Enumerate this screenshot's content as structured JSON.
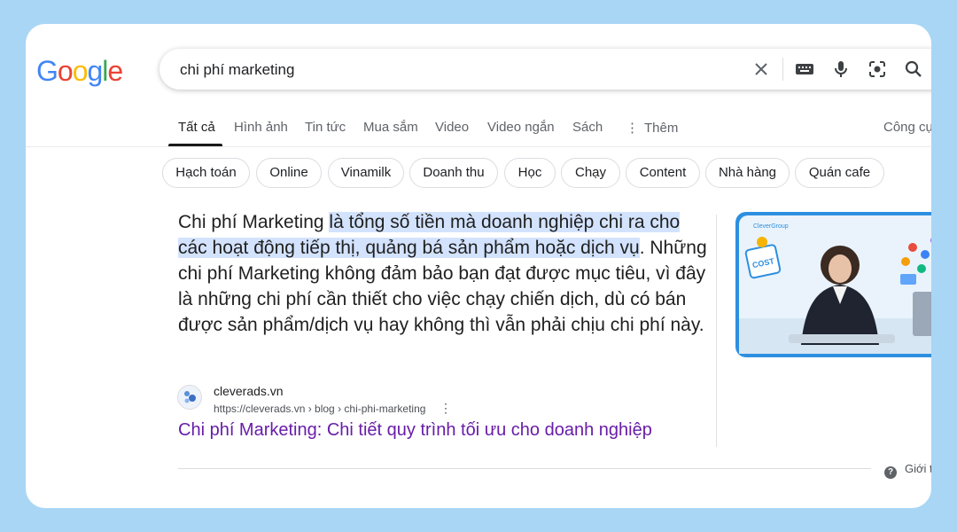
{
  "logo": {
    "letters": [
      "G",
      "o",
      "o",
      "g",
      "l",
      "e"
    ],
    "colors": [
      "#4285F4",
      "#EA4335",
      "#FBBC05",
      "#4285F4",
      "#34A853",
      "#EA4335"
    ]
  },
  "search": {
    "query": "chi phí marketing"
  },
  "tabs": [
    "Tất cả",
    "Hình ảnh",
    "Tin tức",
    "Mua sắm",
    "Video",
    "Video ngắn",
    "Sách",
    "Thêm"
  ],
  "tools_label": "Công cụ",
  "chips": [
    "Hạch toán",
    "Online",
    "Vinamilk",
    "Doanh thu",
    "Học",
    "Chạy",
    "Content",
    "Nhà hàng",
    "Quán cafe"
  ],
  "snippet": {
    "prefix": "Chi phí Marketing ",
    "highlight": "là tổng số tiền mà doanh nghiệp chi ra cho các hoạt động tiếp thị, quảng bá sản phẩm hoặc dịch vụ",
    "suffix": ". Những chi phí Marketing không đảm bảo bạn đạt được mục tiêu, vì đây là những chi phí cần thiết cho việc chạy chiến dịch, dù có bán được sản phẩm/dịch vụ hay không thì vẫn phải chịu chi phí này."
  },
  "source": {
    "site_name": "cleverads.vn",
    "url": "https://cleverads.vn › blog › chi-phi-marketing",
    "title": "Chi phí Marketing: Chi tiết quy trình tối ưu cho doanh nghiệp"
  },
  "thumbnail": {
    "brand": "CleverGroup",
    "badge": "COST"
  },
  "help": {
    "label": "Giới t"
  },
  "colors": {
    "highlight": "#d3e3fd",
    "visited_link": "#681da8",
    "page_bg": "#a9d6f5"
  }
}
